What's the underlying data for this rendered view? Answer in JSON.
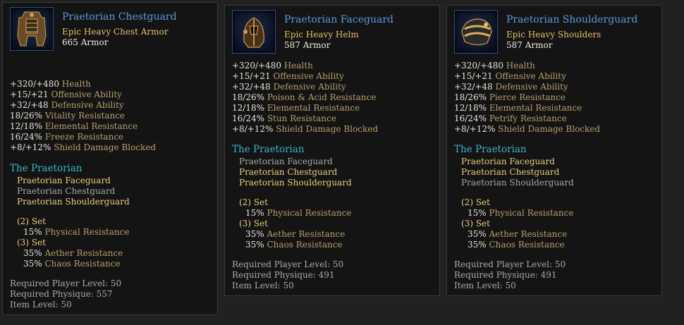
{
  "tooltips": [
    {
      "name": "Praetorian Chestguard",
      "type": "Epic Heavy Chest Armor",
      "armor": "665 Armor",
      "icon": "chest-armor-icon",
      "stats": [
        {
          "value": "+320/+480",
          "label": "Health"
        },
        {
          "value": "+15/+21",
          "label": "Offensive Ability"
        },
        {
          "value": "+32/+48",
          "label": "Defensive Ability"
        },
        {
          "value": "18/26%",
          "label": "Vitality Resistance"
        },
        {
          "value": "12/18%",
          "label": "Elemental Resistance"
        },
        {
          "value": "16/24%",
          "label": "Freeze Resistance"
        },
        {
          "value": "+8/+12%",
          "label": "Shield Damage Blocked"
        }
      ],
      "set_name": "The Praetorian",
      "set_items": [
        "Praetorian Faceguard",
        "Praetorian Chestguard",
        "Praetorian Shoulderguard"
      ],
      "bonus2_label": "(2) Set",
      "bonus2": [
        {
          "value": "15%",
          "label": "Physical Resistance"
        }
      ],
      "bonus3_label": "(3) Set",
      "bonus3": [
        {
          "value": "35%",
          "label": "Aether Resistance"
        },
        {
          "value": "35%",
          "label": "Chaos Resistance"
        }
      ],
      "requirements": [
        "Required Player Level: 50",
        "Required Physique: 557",
        "Item Level: 50"
      ]
    },
    {
      "name": "Praetorian Faceguard",
      "type": "Epic Heavy Helm",
      "armor": "587 Armor",
      "icon": "helm-icon",
      "stats": [
        {
          "value": "+320/+480",
          "label": "Health"
        },
        {
          "value": "+15/+21",
          "label": "Offensive Ability"
        },
        {
          "value": "+32/+48",
          "label": "Defensive Ability"
        },
        {
          "value": "18/26%",
          "label": "Poison & Acid Resistance"
        },
        {
          "value": "12/18%",
          "label": "Elemental Resistance"
        },
        {
          "value": "16/24%",
          "label": "Stun Resistance"
        },
        {
          "value": "+8/+12%",
          "label": "Shield Damage Blocked"
        }
      ],
      "set_name": "The Praetorian",
      "set_items": [
        "Praetorian Faceguard",
        "Praetorian Chestguard",
        "Praetorian Shoulderguard"
      ],
      "bonus2_label": "(2) Set",
      "bonus2": [
        {
          "value": "15%",
          "label": "Physical Resistance"
        }
      ],
      "bonus3_label": "(3) Set",
      "bonus3": [
        {
          "value": "35%",
          "label": "Aether Resistance"
        },
        {
          "value": "35%",
          "label": "Chaos Resistance"
        }
      ],
      "requirements": [
        "Required Player Level: 50",
        "Required Physique: 491",
        "Item Level: 50"
      ]
    },
    {
      "name": "Praetorian Shoulderguard",
      "type": "Epic Heavy Shoulders",
      "armor": "587 Armor",
      "icon": "shoulder-armor-icon",
      "stats": [
        {
          "value": "+320/+480",
          "label": "Health"
        },
        {
          "value": "+15/+21",
          "label": "Offensive Ability"
        },
        {
          "value": "+32/+48",
          "label": "Defensive Ability"
        },
        {
          "value": "18/26%",
          "label": "Pierce Resistance"
        },
        {
          "value": "12/18%",
          "label": "Elemental Resistance"
        },
        {
          "value": "16/24%",
          "label": "Petrify Resistance"
        },
        {
          "value": "+8/+12%",
          "label": "Shield Damage Blocked"
        }
      ],
      "set_name": "The Praetorian",
      "set_items": [
        "Praetorian Faceguard",
        "Praetorian Chestguard",
        "Praetorian Shoulderguard"
      ],
      "bonus2_label": "(2) Set",
      "bonus2": [
        {
          "value": "15%",
          "label": "Physical Resistance"
        }
      ],
      "bonus3_label": "(3) Set",
      "bonus3": [
        {
          "value": "35%",
          "label": "Aether Resistance"
        },
        {
          "value": "35%",
          "label": "Chaos Resistance"
        }
      ],
      "requirements": [
        "Required Player Level: 50",
        "Required Physique: 491",
        "Item Level: 50"
      ]
    }
  ]
}
